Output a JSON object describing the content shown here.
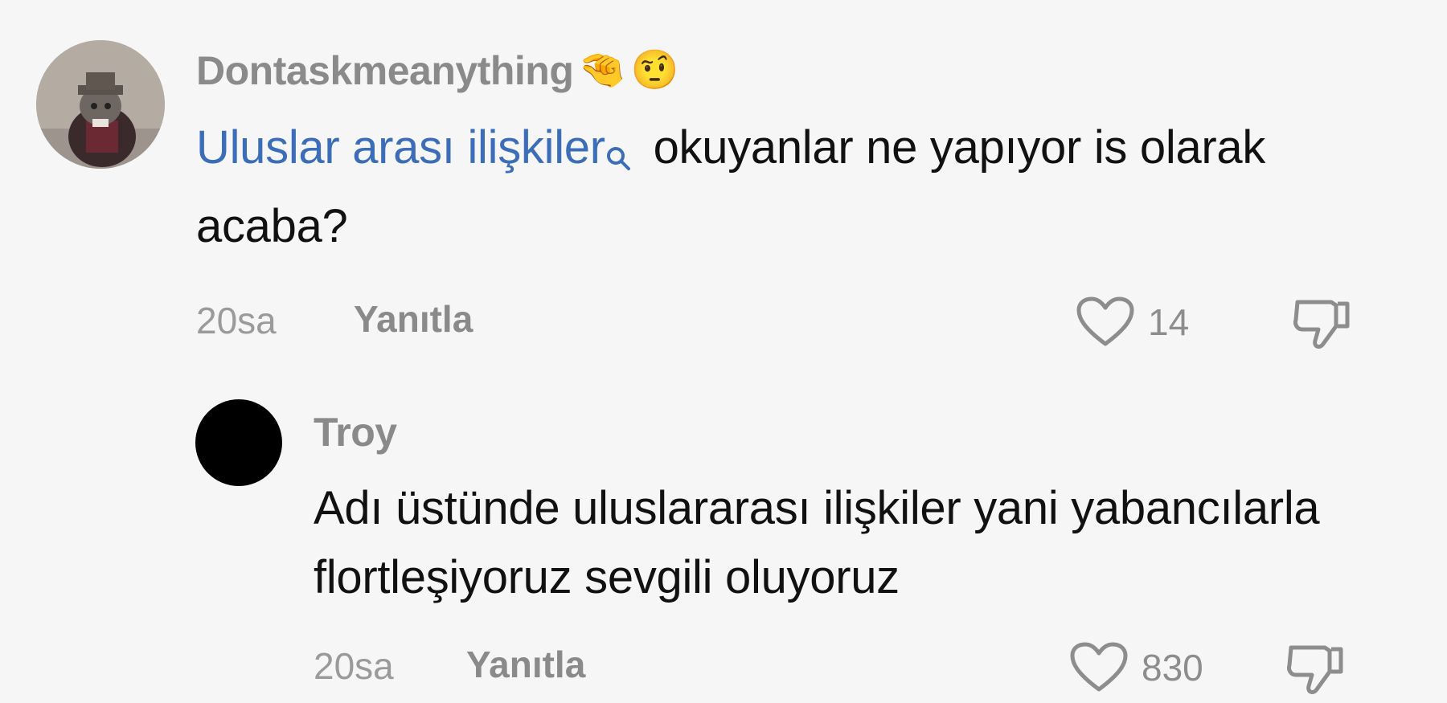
{
  "comment1": {
    "username": "Dontaskmeanything",
    "emoji_1": "🤏",
    "emoji_2": "🤨",
    "link_text": "Uluslar arası ilişkiler",
    "text": " okuyanlar ne yapıyor is olarak acaba?",
    "time": "20sa",
    "reply_label": "Yanıtla",
    "likes": "14"
  },
  "comment2": {
    "username": "Troy",
    "text": "Adı üstünde uluslararası ilişkiler yani yabancılarla flortleşiyoruz sevgili oluyoruz",
    "time": "20sa",
    "reply_label": "Yanıtla",
    "likes": "830"
  },
  "colors": {
    "background": "#f6f6f6",
    "link": "#3c6db8",
    "muted": "#8a8a8a",
    "text": "#111111"
  },
  "icons": [
    "heart-icon",
    "thumbs-down-icon",
    "search-icon"
  ]
}
